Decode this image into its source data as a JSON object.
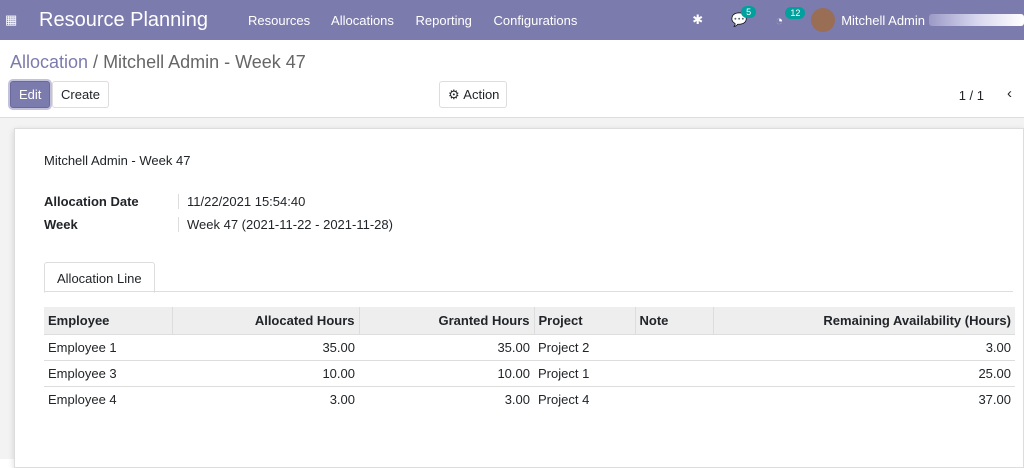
{
  "nav": {
    "app_title": "Resource Planning",
    "menu": [
      "Resources",
      "Allocations",
      "Reporting",
      "Configurations"
    ],
    "messages_count": "5",
    "activities_count": "12",
    "user": "Mitchell Admin"
  },
  "breadcrumb": {
    "parent": "Allocation",
    "separator": " / ",
    "current": "Mitchell Admin - Week 47"
  },
  "toolbar": {
    "edit": "Edit",
    "create": "Create",
    "action": "Action",
    "pager": "1 / 1"
  },
  "form": {
    "title": "Mitchell Admin - Week 47",
    "fields": [
      {
        "label": "Allocation Date",
        "value": "11/22/2021 15:54:40"
      },
      {
        "label": "Week",
        "value": "Week 47 (2021-11-22 - 2021-11-28)"
      }
    ],
    "tab": "Allocation Line",
    "columns": [
      "Employee",
      "Allocated Hours",
      "Granted Hours",
      "Project",
      "Note",
      "Remaining Availability (Hours)"
    ],
    "rows": [
      [
        "Employee 1",
        "35.00",
        "35.00",
        "Project 2",
        "",
        "3.00"
      ],
      [
        "Employee 3",
        "10.00",
        "10.00",
        "Project 1",
        "",
        "25.00"
      ],
      [
        "Employee 4",
        "3.00",
        "3.00",
        "Project 4",
        "",
        "37.00"
      ]
    ]
  }
}
